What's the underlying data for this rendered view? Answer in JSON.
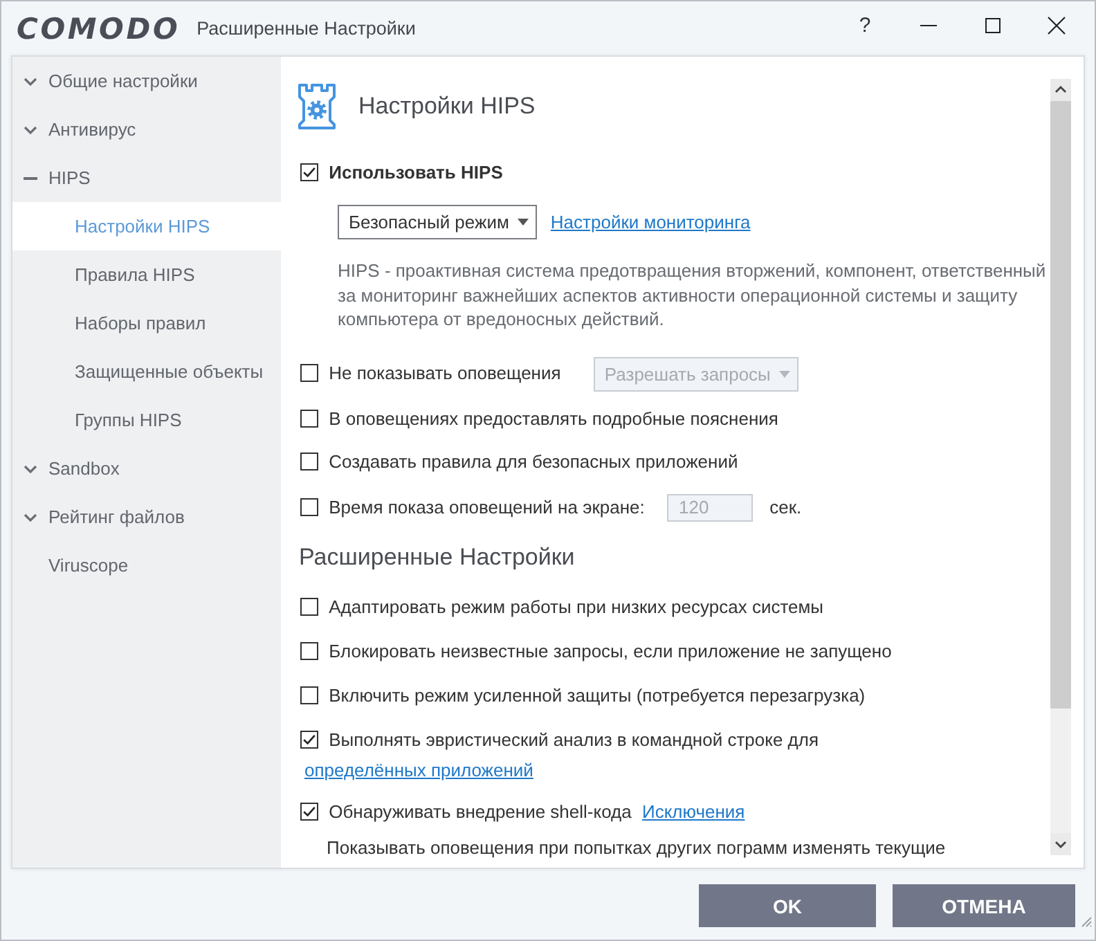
{
  "window": {
    "logo": "COMODO",
    "title": "Расширенные Настройки",
    "help": "?"
  },
  "sidebar": {
    "items": [
      {
        "kind": "group",
        "label": "Общие настройки",
        "expanded": false,
        "selected": false
      },
      {
        "kind": "group",
        "label": "Антивирус",
        "expanded": false,
        "selected": false
      },
      {
        "kind": "group",
        "label": "HIPS",
        "expanded": true,
        "selected": false,
        "children": [
          {
            "label": "Настройки HIPS",
            "selected": true
          },
          {
            "label": "Правила HIPS",
            "selected": false
          },
          {
            "label": "Наборы правил",
            "selected": false
          },
          {
            "label": "Защищенные объекты",
            "selected": false
          },
          {
            "label": "Группы HIPS",
            "selected": false
          }
        ]
      },
      {
        "kind": "group",
        "label": "Sandbox",
        "expanded": false,
        "selected": false
      },
      {
        "kind": "group",
        "label": "Рейтинг файлов",
        "expanded": false,
        "selected": false
      },
      {
        "kind": "leaf",
        "label": "Viruscope",
        "selected": false
      }
    ]
  },
  "panel": {
    "title": "Настройки HIPS",
    "main_option": {
      "label": "Использовать HIPS",
      "checked": true
    },
    "mode": {
      "value": "Безопасный режим",
      "link": "Настройки мониторинга"
    },
    "description": "HIPS - проактивная система предотвращения вторжений, компонент, ответственный за мониторинг важнейших аспектов активности операционной системы и защиту компьютера от вредоносных действий.",
    "options": [
      {
        "kind": "select",
        "label": "Не показывать оповещения",
        "checked": false,
        "select": {
          "value": "Разрешать запросы",
          "disabled": true
        }
      },
      {
        "kind": "plain",
        "label": "В оповещениях предоставлять подробные пояснения",
        "checked": false
      },
      {
        "kind": "plain",
        "label": "Создавать правила для безопасных приложений",
        "checked": false
      },
      {
        "kind": "input",
        "label": "Время показа оповещений на экране:",
        "checked": false,
        "input": {
          "value": "120",
          "disabled": true
        },
        "unit": "сек."
      }
    ],
    "advanced_title": "Расширенные Настройки",
    "advanced_options": [
      {
        "kind": "plain",
        "label": "Адаптировать режим работы при низких ресурсах системы",
        "checked": false
      },
      {
        "kind": "plain",
        "label": "Блокировать неизвестные запросы, если приложение не запущено",
        "checked": false
      },
      {
        "kind": "plain",
        "label": "Включить режим усиленной защиты (потребуется перезагрузка)",
        "checked": false
      },
      {
        "kind": "link",
        "label": "Выполнять эвристический анализ в командной строке для",
        "link": "определённых приложений",
        "checked": true
      },
      {
        "kind": "link",
        "label": "Обнаруживать внедрение shell-кода",
        "link": "Исключения",
        "checked": true
      },
      {
        "kind": "text",
        "label": "Показывать оповещения при попытках других пограмм изменять текущие"
      }
    ]
  },
  "buttons": [
    "OK",
    "ОТМЕНА"
  ]
}
